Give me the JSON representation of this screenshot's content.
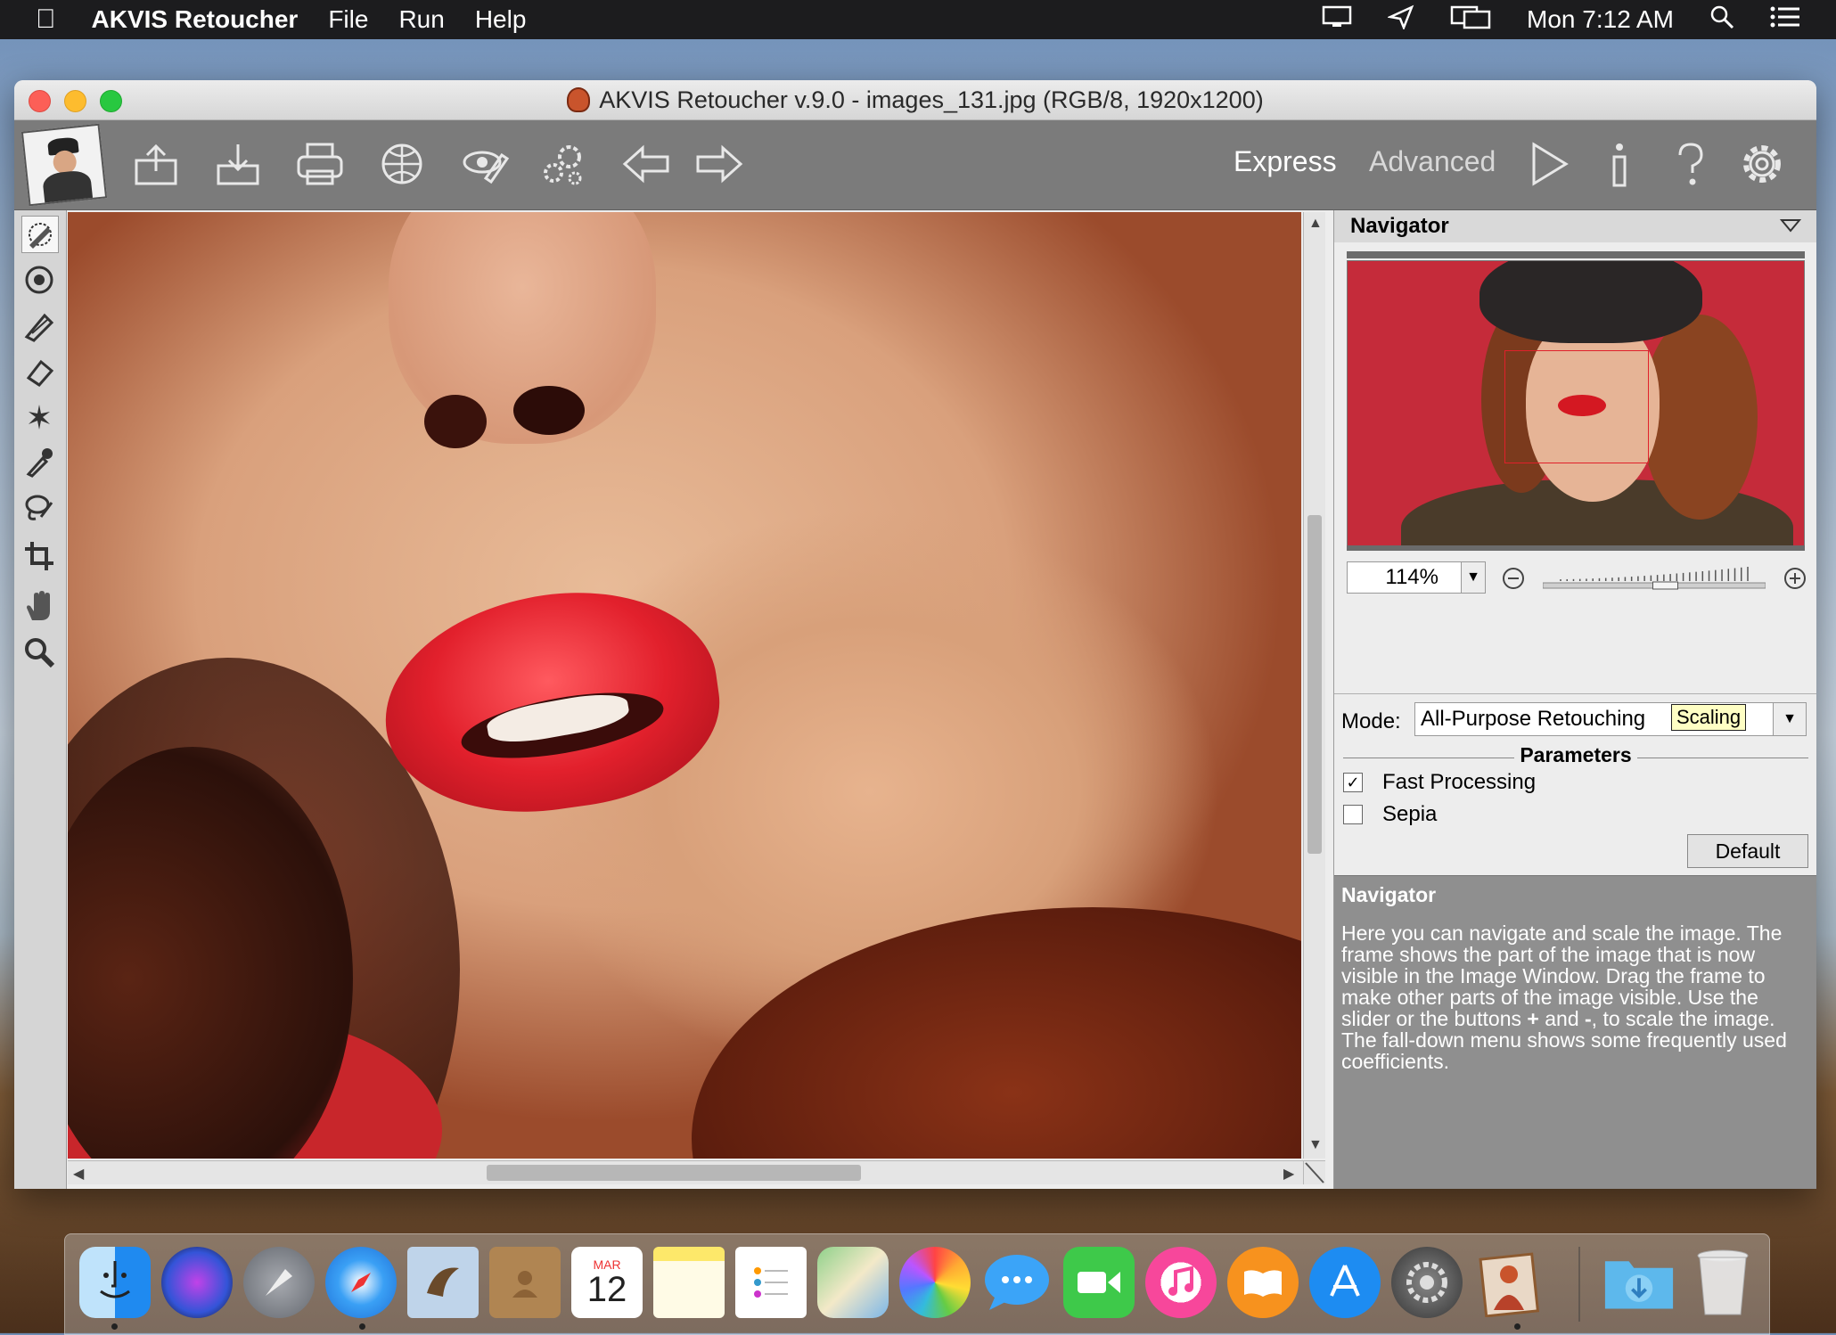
{
  "menubar": {
    "app_name": "AKVIS Retoucher",
    "menus": [
      "File",
      "Run",
      "Help"
    ],
    "clock": "Mon 7:12 AM"
  },
  "window": {
    "title": "AKVIS Retoucher v.9.0 - images_131.jpg (RGB/8, 1920x1200)"
  },
  "toolbar": {
    "modes": {
      "express": "Express",
      "advanced": "Advanced"
    },
    "icons": [
      "open-icon",
      "save-icon",
      "print-icon",
      "share-icon",
      "preferences-icon",
      "batch-icon",
      "undo-icon",
      "redo-icon",
      "run-icon",
      "info-icon",
      "help-icon",
      "settings-icon"
    ]
  },
  "tools": [
    "retouch-brush-icon",
    "clone-icon",
    "chameleon-brush-icon",
    "eraser-icon",
    "magic-wand-icon",
    "pipette-icon",
    "lasso-icon",
    "crop-icon",
    "hand-icon",
    "zoom-icon"
  ],
  "navigator": {
    "title": "Navigator",
    "zoom": "114%",
    "slider_value": 0.55
  },
  "mode": {
    "label": "Mode:",
    "value": "All-Purpose Retouching",
    "tooltip": "Scaling"
  },
  "parameters": {
    "title": "Parameters",
    "fast_processing": {
      "label": "Fast Processing",
      "checked": true
    },
    "sepia": {
      "label": "Sepia",
      "checked": false
    },
    "default_button": "Default"
  },
  "help": {
    "title": "Navigator",
    "text_before_plus": "Here you can navigate and scale the image. The frame shows the part of the image that is now visible in the Image Window. Drag the frame to make other parts of the image visible. Use the slider or the buttons ",
    "plus": "+",
    "and": " and ",
    "minus": "-",
    "text_after_minus": ", to scale the image. The fall-down menu shows some frequently used coefficients."
  },
  "dock": {
    "calendar_month": "MAR",
    "calendar_day": "12",
    "apps": [
      "finder",
      "siri",
      "launchpad",
      "safari",
      "mail",
      "contacts",
      "calendar",
      "notes",
      "reminders",
      "maps",
      "photos",
      "messages",
      "facetime",
      "itunes",
      "ibooks",
      "app-store",
      "system-preferences",
      "akvis-retoucher",
      "downloads",
      "trash"
    ]
  }
}
